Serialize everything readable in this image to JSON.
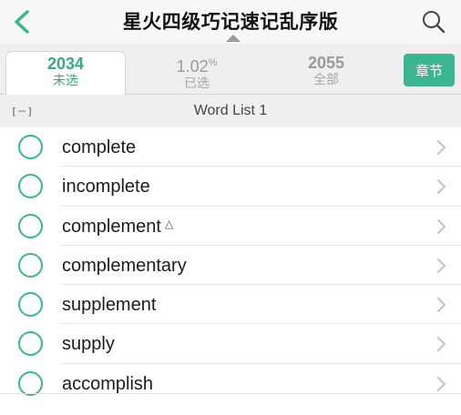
{
  "nav": {
    "title": "星火四级巧记速记乱序版"
  },
  "tabs": {
    "unselected": {
      "count": "2034",
      "label": "未选"
    },
    "selected": {
      "percent": "1.02",
      "percent_sign": "%",
      "label": "已选"
    },
    "all": {
      "count": "2055",
      "label": "全部"
    },
    "chapter_button": "章节"
  },
  "section": {
    "collapse_label": "[－]",
    "title": "Word List 1"
  },
  "words": [
    {
      "text": "complete",
      "mark": ""
    },
    {
      "text": "incomplete",
      "mark": ""
    },
    {
      "text": "complement",
      "mark": "△"
    },
    {
      "text": "complementary",
      "mark": ""
    },
    {
      "text": "supplement",
      "mark": ""
    },
    {
      "text": "supply",
      "mark": ""
    },
    {
      "text": "accomplish",
      "mark": ""
    }
  ],
  "colors": {
    "accent": "#3bb592",
    "accent_text": "#3aa784",
    "muted": "#9a9a9a"
  },
  "icons": {
    "back": "chevron-left-icon",
    "search": "search-icon",
    "row_check": "circle-outline-icon",
    "row_chevron": "chevron-right-icon"
  }
}
